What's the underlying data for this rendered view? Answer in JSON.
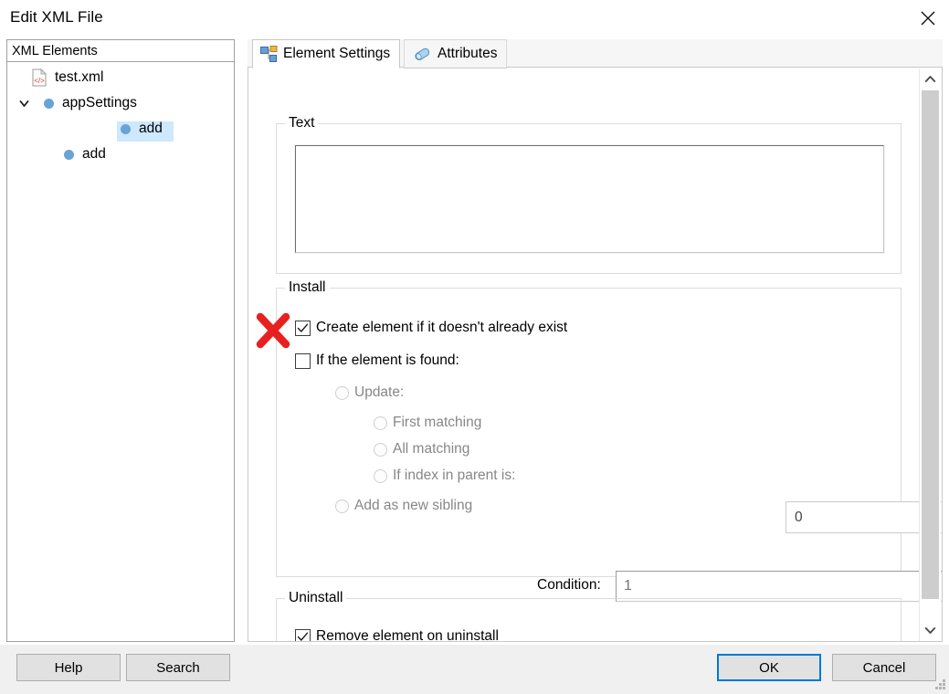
{
  "window": {
    "title": "Edit XML File",
    "close_icon": "close-icon"
  },
  "tree": {
    "header": "XML Elements",
    "nodes": [
      {
        "label": "test.xml",
        "icon": "xml-file-icon",
        "indent": 6,
        "selected": false,
        "expander": ""
      },
      {
        "label": "appSettings",
        "icon": "dot-icon",
        "indent": 34,
        "selected": false,
        "expander": "chevron-down-icon"
      },
      {
        "label": "add",
        "icon": "dot-icon",
        "indent": 62,
        "selected": true,
        "expander": ""
      },
      {
        "label": "add",
        "icon": "dot-icon",
        "indent": 62,
        "selected": false,
        "expander": ""
      }
    ]
  },
  "tabs": [
    {
      "label": "Element Settings",
      "icon": "element-tree-icon",
      "active": true
    },
    {
      "label": "Attributes",
      "icon": "attribute-pill-icon",
      "active": false
    }
  ],
  "groups": {
    "text": {
      "title": "Text",
      "value": "",
      "placeholder": ""
    },
    "install": {
      "title": "Install"
    },
    "uninstall": {
      "title": "Uninstall"
    }
  },
  "install": {
    "create_element": {
      "label": "Create element if it doesn't already exist",
      "checked": true
    },
    "if_found": {
      "label": "If the element is found:",
      "checked": false
    },
    "update": {
      "label": "Update:",
      "selected": false,
      "disabled": true
    },
    "first_matching": {
      "label": "First matching",
      "selected": false,
      "disabled": true
    },
    "all_matching": {
      "label": "All matching",
      "selected": false,
      "disabled": true
    },
    "index_in_parent": {
      "label": "If index in parent is:",
      "selected": false,
      "disabled": true
    },
    "index_value": "0",
    "add_sibling": {
      "label": "Add as new sibling",
      "selected": false,
      "disabled": true
    },
    "condition": {
      "label": "Condition:",
      "value": "1",
      "browse_label": "..."
    }
  },
  "uninstall": {
    "remove_element": {
      "label": "Remove element on uninstall",
      "checked": true
    }
  },
  "scrollbar": {
    "up_icon": "chevron-up-icon",
    "down_icon": "chevron-down-icon"
  },
  "footer": {
    "help": "Help",
    "search": "Search",
    "ok": "OK",
    "cancel": "Cancel"
  },
  "annotation": {
    "red_x": "red-x-mark"
  },
  "colors": {
    "accent": "#0078d7",
    "selection": "#cde8ff",
    "node_dot": "#6aa3d5",
    "disabled_text": "#878787",
    "annotation_red": "#e8201f",
    "button_face": "#e1e1e1",
    "dialog_bg": "#f0f0f0"
  }
}
